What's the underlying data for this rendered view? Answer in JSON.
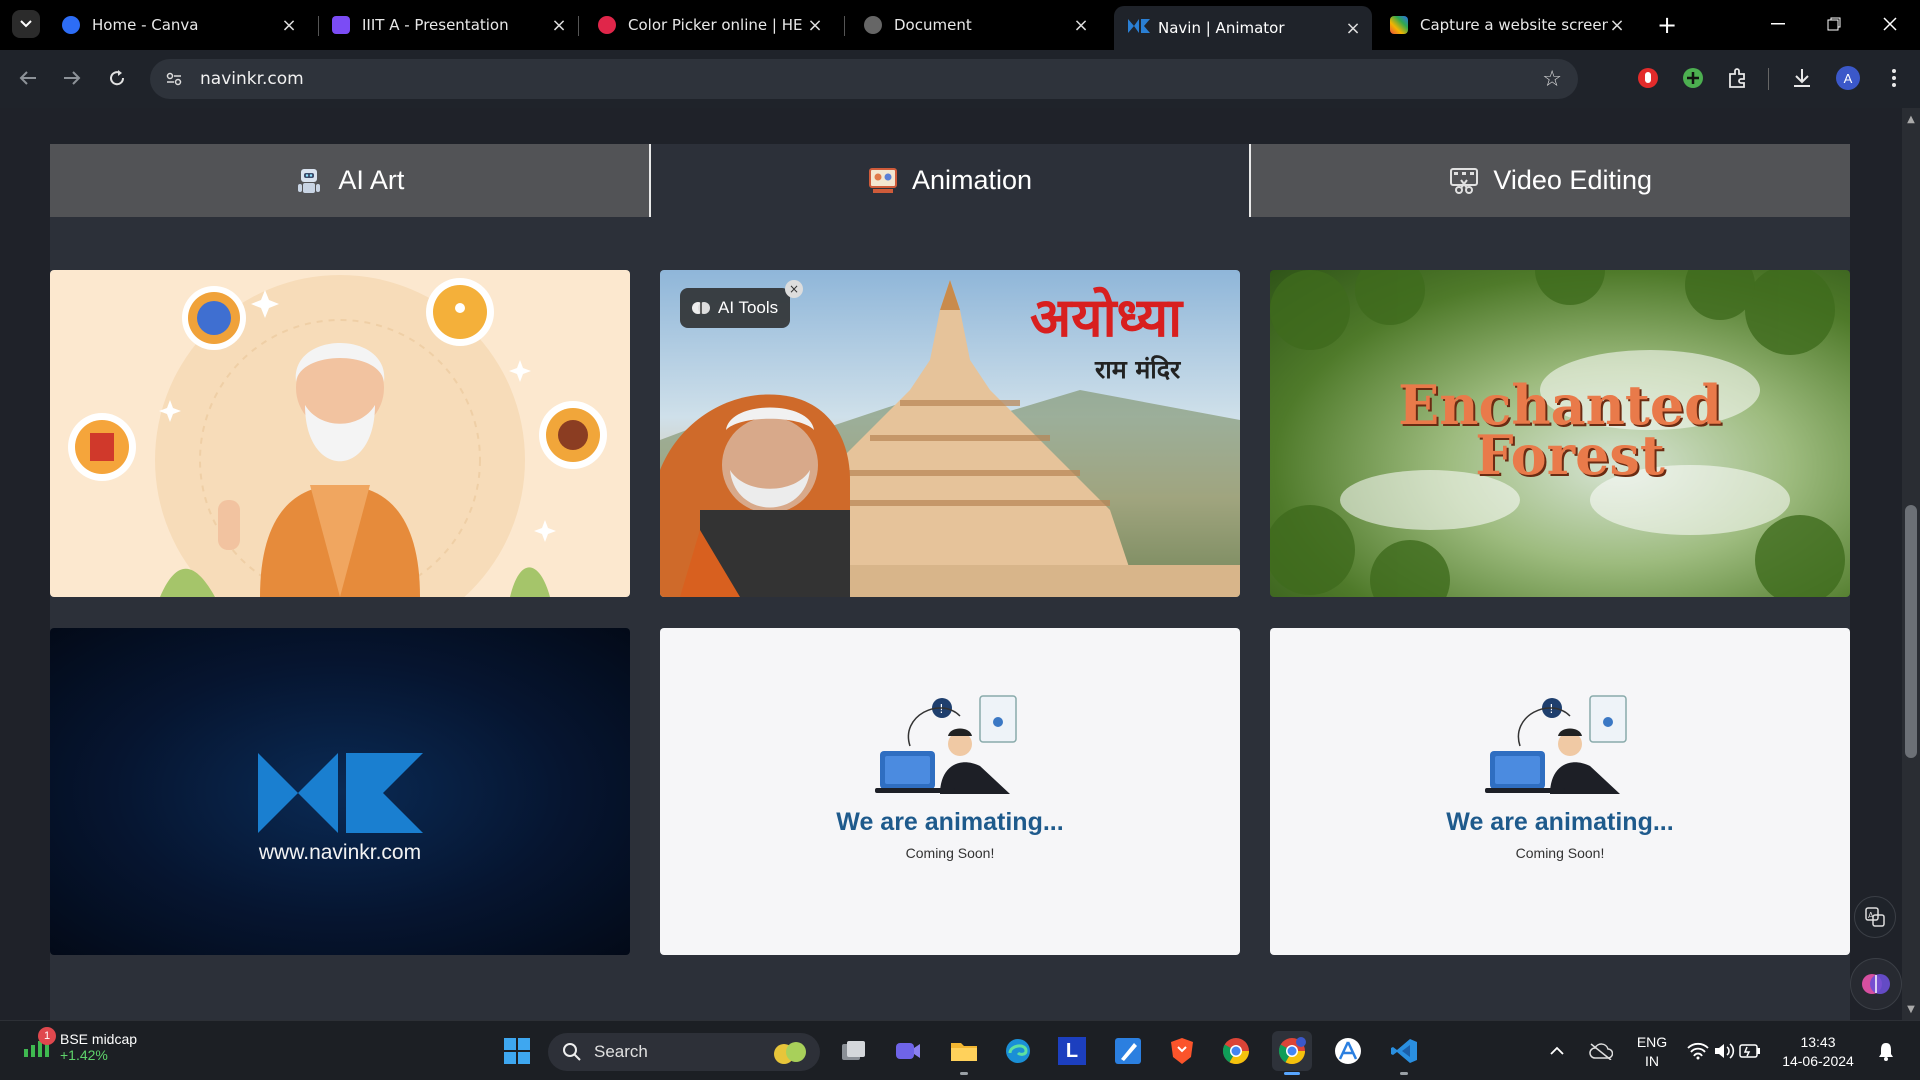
{
  "browser": {
    "tabs": [
      {
        "title": "Home - Canva",
        "favicon_color": "#2d6df6"
      },
      {
        "title": "IIIT A - Presentation",
        "favicon_color": "#7b4cf5"
      },
      {
        "title": "Color Picker online | HE",
        "favicon_color": "#e0264a"
      },
      {
        "title": "Document",
        "favicon_color": "#666666"
      },
      {
        "title": "Navin | Animator",
        "favicon_color": "#2a7fd4"
      },
      {
        "title": "Capture a website screensh",
        "favicon_color": "#e94b3c"
      }
    ],
    "active_tab_index": 4,
    "url": "navinkr.com",
    "profile_initial": "A"
  },
  "page": {
    "category_tabs": [
      {
        "label": "AI Art",
        "icon": "robot-icon"
      },
      {
        "label": "Animation",
        "icon": "presentation-icon"
      },
      {
        "label": "Video Editing",
        "icon": "film-editing-icon"
      }
    ],
    "active_category_index": 1,
    "cards": [
      {
        "type": "image",
        "description_icon": "sage-illustration"
      },
      {
        "type": "image",
        "overlay_text_hi": "अयोध्या",
        "overlay_sub_hi": "राम मंदिर",
        "badge": "AI Tools"
      },
      {
        "type": "image",
        "overlay_text": "Enchanted",
        "overlay_text2": "Forest"
      },
      {
        "type": "logo",
        "site": "www.navinkr.com"
      },
      {
        "type": "placeholder",
        "heading": "We are animating...",
        "sub": "Coming Soon!"
      },
      {
        "type": "placeholder",
        "heading": "We are animating...",
        "sub": "Coming Soon!"
      }
    ]
  },
  "taskbar": {
    "stock_name": "BSE midcap",
    "stock_change": "+1.42%",
    "notification_count": "1",
    "search_label": "Search",
    "lang": "ENG",
    "region": "IN",
    "time": "13:43",
    "date": "14-06-2024"
  },
  "colors": {
    "accent_blue": "#1e5a8c",
    "chrome_bg": "#1f232a",
    "page_bg": "#1f2229"
  }
}
